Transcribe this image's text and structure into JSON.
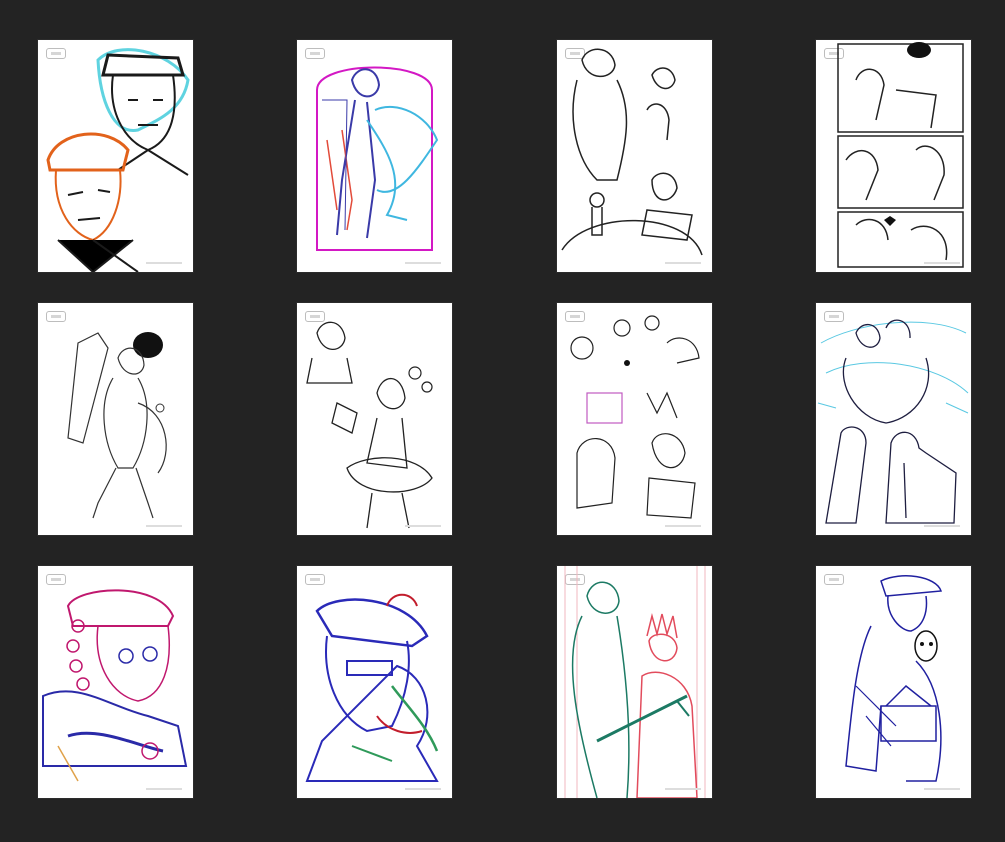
{
  "gallery": {
    "background": "#232323",
    "items": [
      {
        "id": "sketch-1",
        "palette": [
          "#1a1a1a",
          "#5fd3e0",
          "#e2621b"
        ]
      },
      {
        "id": "sketch-2",
        "palette": [
          "#3a3aa8",
          "#d318c4",
          "#e24b3a",
          "#3fb7e0"
        ]
      },
      {
        "id": "sketch-3",
        "palette": [
          "#222222"
        ]
      },
      {
        "id": "sketch-4",
        "palette": [
          "#222222"
        ]
      },
      {
        "id": "sketch-5",
        "palette": [
          "#333333"
        ]
      },
      {
        "id": "sketch-6",
        "palette": [
          "#222222"
        ]
      },
      {
        "id": "sketch-7",
        "palette": [
          "#222222",
          "#c05ac0"
        ]
      },
      {
        "id": "sketch-8",
        "palette": [
          "#1e1e40",
          "#59c8e2"
        ]
      },
      {
        "id": "sketch-9",
        "palette": [
          "#2a2aa8",
          "#c0186e",
          "#e0a24a"
        ]
      },
      {
        "id": "sketch-10",
        "palette": [
          "#2a2ab8",
          "#2f9a5a",
          "#c21d2c"
        ]
      },
      {
        "id": "sketch-11",
        "palette": [
          "#1c7a64",
          "#e24b5c"
        ]
      },
      {
        "id": "sketch-12",
        "palette": [
          "#2020a0",
          "#111111"
        ]
      }
    ]
  }
}
